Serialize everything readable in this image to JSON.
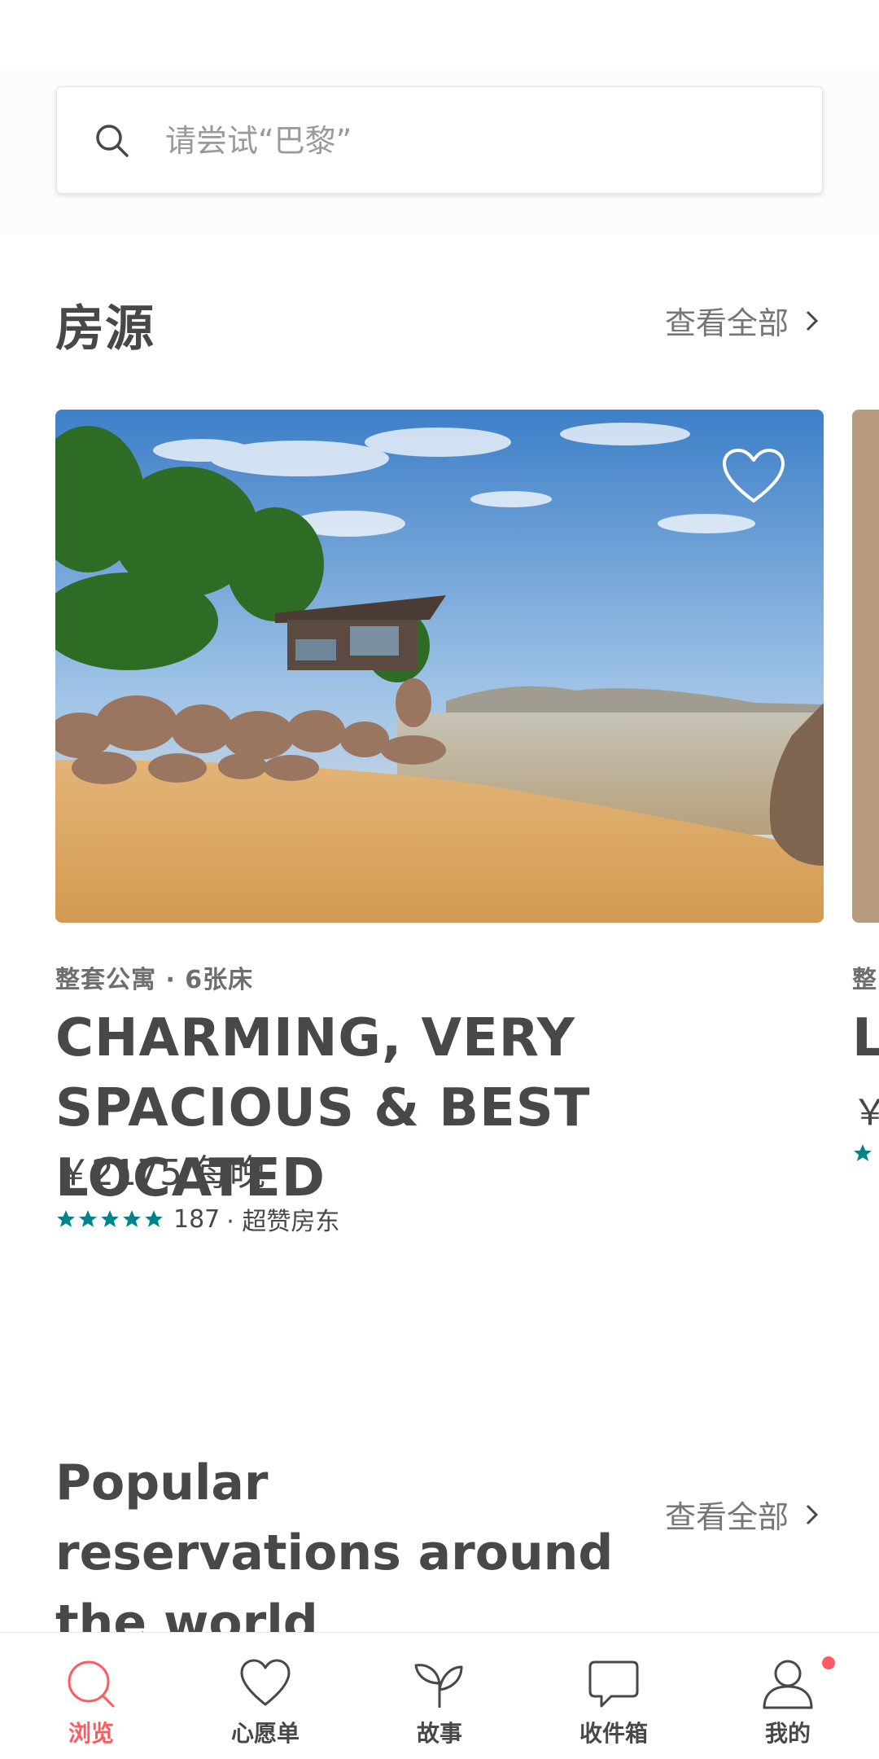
{
  "search": {
    "placeholder": "请尝试“巴黎”",
    "icon": "search-icon"
  },
  "listings_section": {
    "title": "房源",
    "see_all": "查看全部"
  },
  "listing": {
    "type": "整套公寓 · 6张床",
    "title": "CHARMING, VERY SPACIOUS & BEST LOCATED",
    "price": "￥2175 每晚",
    "stars": 5,
    "review_count": "187",
    "host_badge": "· 超赞房东",
    "favorite_icon": "heart-outline-icon"
  },
  "peek_listing": {
    "type": "整",
    "title": "L",
    "price": "￥"
  },
  "popular_section": {
    "title": "Popular reservations around the world",
    "see_all": "查看全部"
  },
  "tabbar": {
    "tabs": [
      {
        "label": "浏览",
        "icon": "search-icon",
        "active": true
      },
      {
        "label": "心愿单",
        "icon": "heart-icon",
        "active": false
      },
      {
        "label": "故事",
        "icon": "sprout-icon",
        "active": false
      },
      {
        "label": "收件箱",
        "icon": "chat-bubble-icon",
        "active": false
      },
      {
        "label": "我的",
        "icon": "profile-icon",
        "active": false
      }
    ]
  },
  "colors": {
    "accent": "#ff5a5f",
    "star": "#008489",
    "text": "#484848",
    "muted": "#767676"
  }
}
